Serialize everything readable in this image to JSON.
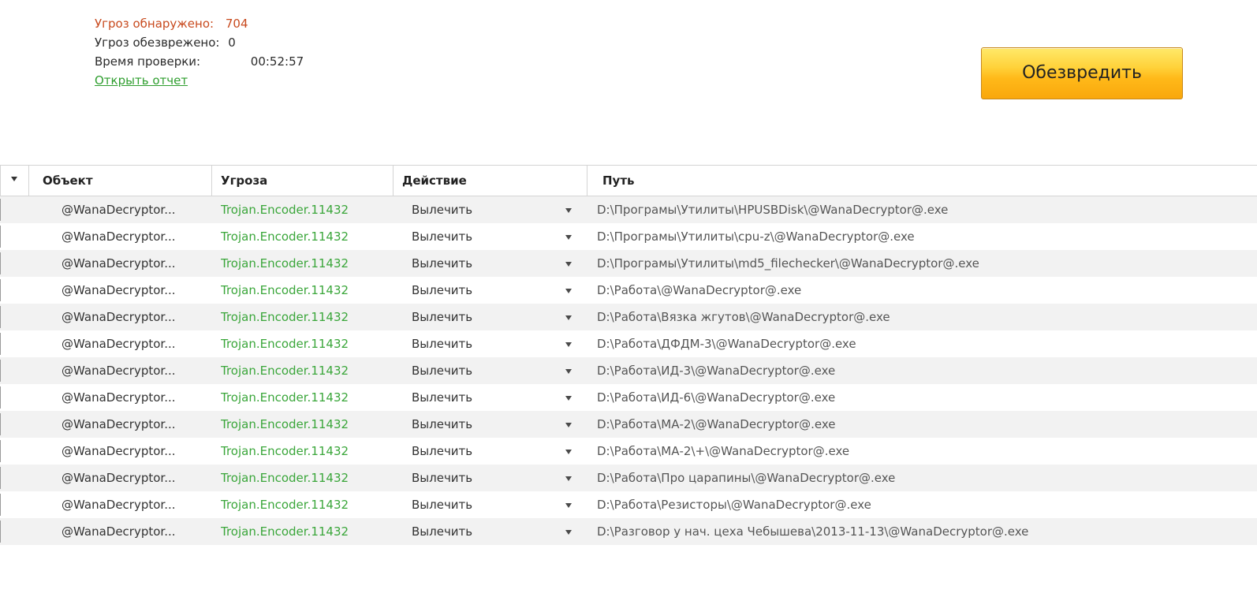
{
  "summary": {
    "threats_found_label": "Угроз обнаружено:",
    "threats_found_value": "704",
    "threats_cleaned_label": "Угроз обезврежено:",
    "threats_cleaned_value": "0",
    "scan_time_label": "Время проверки:",
    "scan_time_value": "00:52:57",
    "open_report_link": "Открыть отчет"
  },
  "actions": {
    "neutralize_button": "Обезвредить"
  },
  "table": {
    "columns": {
      "object": "Объект",
      "threat": "Угроза",
      "action": "Действие",
      "path": "Путь"
    },
    "rows": [
      {
        "object": "@WanaDecryptor...",
        "threat": "Trojan.Encoder.11432",
        "action": "Вылечить",
        "path": "D:\\Програмы\\Утилиты\\HPUSBDisk\\@WanaDecryptor@.exe"
      },
      {
        "object": "@WanaDecryptor...",
        "threat": "Trojan.Encoder.11432",
        "action": "Вылечить",
        "path": "D:\\Програмы\\Утилиты\\cpu-z\\@WanaDecryptor@.exe"
      },
      {
        "object": "@WanaDecryptor...",
        "threat": "Trojan.Encoder.11432",
        "action": "Вылечить",
        "path": "D:\\Програмы\\Утилиты\\md5_filechecker\\@WanaDecryptor@.exe"
      },
      {
        "object": "@WanaDecryptor...",
        "threat": "Trojan.Encoder.11432",
        "action": "Вылечить",
        "path": "D:\\Работа\\@WanaDecryptor@.exe"
      },
      {
        "object": "@WanaDecryptor...",
        "threat": "Trojan.Encoder.11432",
        "action": "Вылечить",
        "path": "D:\\Работа\\Вязка жгутов\\@WanaDecryptor@.exe"
      },
      {
        "object": "@WanaDecryptor...",
        "threat": "Trojan.Encoder.11432",
        "action": "Вылечить",
        "path": "D:\\Работа\\ДФДМ-3\\@WanaDecryptor@.exe"
      },
      {
        "object": "@WanaDecryptor...",
        "threat": "Trojan.Encoder.11432",
        "action": "Вылечить",
        "path": "D:\\Работа\\ИД-3\\@WanaDecryptor@.exe"
      },
      {
        "object": "@WanaDecryptor...",
        "threat": "Trojan.Encoder.11432",
        "action": "Вылечить",
        "path": "D:\\Работа\\ИД-6\\@WanaDecryptor@.exe"
      },
      {
        "object": "@WanaDecryptor...",
        "threat": "Trojan.Encoder.11432",
        "action": "Вылечить",
        "path": "D:\\Работа\\МА-2\\@WanaDecryptor@.exe"
      },
      {
        "object": "@WanaDecryptor...",
        "threat": "Trojan.Encoder.11432",
        "action": "Вылечить",
        "path": "D:\\Работа\\МА-2\\+\\@WanaDecryptor@.exe"
      },
      {
        "object": "@WanaDecryptor...",
        "threat": "Trojan.Encoder.11432",
        "action": "Вылечить",
        "path": "D:\\Работа\\Про царапины\\@WanaDecryptor@.exe"
      },
      {
        "object": "@WanaDecryptor...",
        "threat": "Trojan.Encoder.11432",
        "action": "Вылечить",
        "path": "D:\\Работа\\Резисторы\\@WanaDecryptor@.exe"
      },
      {
        "object": "@WanaDecryptor...",
        "threat": "Trojan.Encoder.11432",
        "action": "Вылечить",
        "path": "D:\\Разговор у нач. цеха Чебышева\\2013-11-13\\@WanaDecryptor@.exe"
      }
    ]
  },
  "colors": {
    "threat_text": "#3aa63a",
    "found_text": "#c84a1e",
    "link_text": "#2f9e2f",
    "button_fill": "#ffc21f"
  },
  "icons": {
    "sort": "sort-down-arrow-icon",
    "dropdown": "chevron-down-icon"
  }
}
